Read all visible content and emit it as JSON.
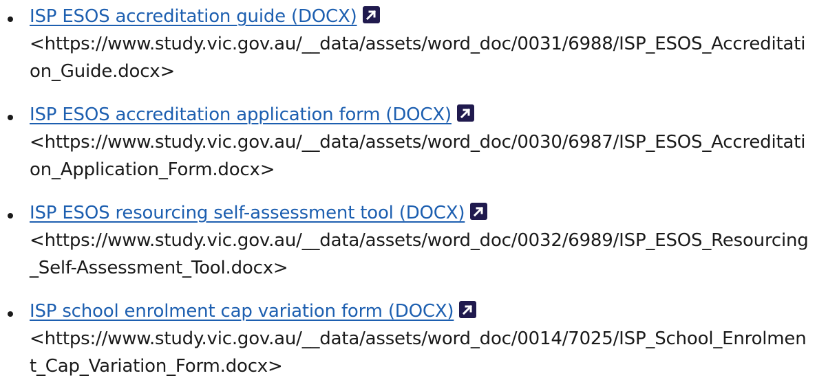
{
  "documents": [
    {
      "link_text": "ISP ESOS accreditation guide (DOCX)",
      "url_text": "<https://www.study.vic.gov.au/__data/assets/word_doc/0031/6988/ISP_ESOS_Accreditation_Guide.docx>",
      "icon": "external-link-icon"
    },
    {
      "link_text": "ISP ESOS accreditation application form (DOCX)",
      "url_text": "<https://www.study.vic.gov.au/__data/assets/word_doc/0030/6987/ISP_ESOS_Accreditation_Application_Form.docx>",
      "icon": "external-link-icon"
    },
    {
      "link_text": "ISP ESOS resourcing self-assessment tool (DOCX)",
      "url_text": "<https://www.study.vic.gov.au/__data/assets/word_doc/0032/6989/ISP_ESOS_Resourcing_Self-Assessment_Tool.docx>",
      "icon": "external-link-icon"
    },
    {
      "link_text": "ISP school enrolment cap variation form (DOCX)",
      "url_text": "<https://www.study.vic.gov.au/__data/assets/word_doc/0014/7025/ISP_School_Enrolment_Cap_Variation_Form.docx>",
      "icon": "external-link-icon"
    }
  ],
  "colors": {
    "link": "#1d5fb0",
    "icon_bg": "#201a4e",
    "text": "#1a1a1a"
  }
}
